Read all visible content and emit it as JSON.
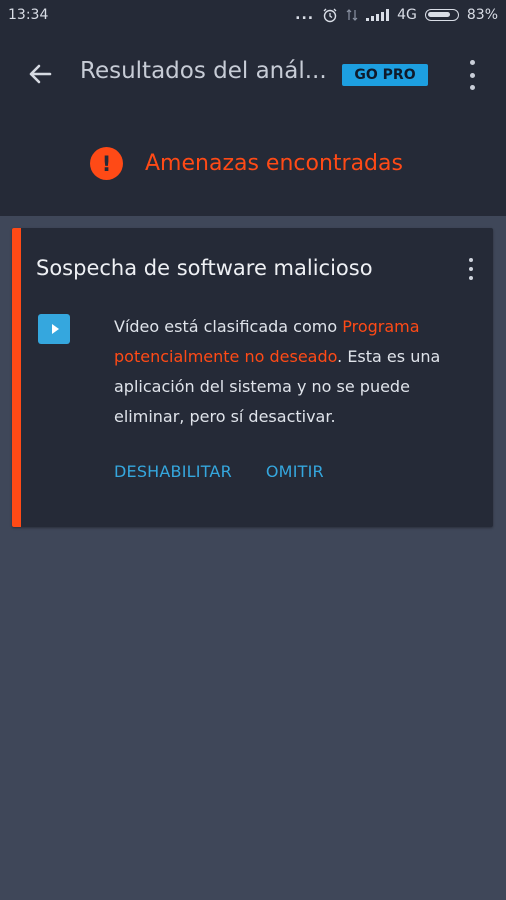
{
  "status_bar": {
    "time": "13:34",
    "dots": "...",
    "network": "4G",
    "battery": "83%",
    "battery_level": 0.83
  },
  "app_bar": {
    "title": "Resultados del anál...",
    "pro_badge": "GO PRO",
    "icons": [
      "arrow-back",
      "more-vert"
    ]
  },
  "alert": {
    "text": "Amenazas encontradas",
    "icon_glyph": "!",
    "color": "#ff4a16"
  },
  "card": {
    "title": "Sospecha de software malicioso",
    "app_icon": "video-play",
    "description_prefix": "Vídeo está clasificada como ",
    "description_highlight": "Programa potencialmente no deseado",
    "description_suffix": ". Esta es una aplicación del sistema y no se puede eliminar, pero sí desactivar.",
    "actions": {
      "disable": "DESHABILITAR",
      "skip": "OMITIR"
    }
  },
  "colors": {
    "accent_orange": "#ff4a16",
    "accent_blue": "#35a7de",
    "header_bg": "#252a37",
    "content_bg": "#3f4759"
  }
}
